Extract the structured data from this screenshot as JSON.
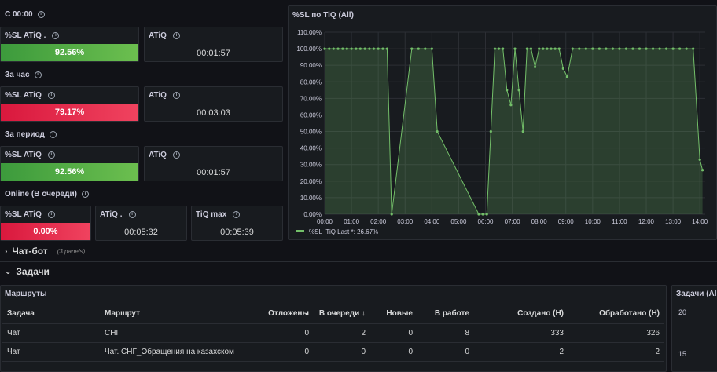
{
  "sections": {
    "since_midnight": "С 00:00",
    "per_hour": "За час",
    "per_period": "За период",
    "online": "Online (В очереди)"
  },
  "stats": {
    "r1_sl": {
      "title": "%SL ATiQ .",
      "value": "92.56%"
    },
    "r1_atiq": {
      "title": "ATiQ",
      "value": "00:01:57"
    },
    "r2_sl": {
      "title": "%SL ATiQ",
      "value": "79.17%"
    },
    "r2_atiq": {
      "title": "ATiQ",
      "value": "00:03:03"
    },
    "r3_sl": {
      "title": "%SL ATiQ",
      "value": "92.56%"
    },
    "r3_atiq": {
      "title": "ATiQ",
      "value": "00:01:57"
    },
    "r4_sl": {
      "title": "%SL ATiQ",
      "value": "0.00%"
    },
    "r4_atiq": {
      "title": "ATiQ .",
      "value": "00:05:32"
    },
    "r4_tiqmax": {
      "title": "TiQ max",
      "value": "00:05:39"
    }
  },
  "colors": {
    "green": "#56a64b",
    "red": "#e02f44",
    "line": "#73bf69"
  },
  "chart_data": {
    "type": "line",
    "title": "%SL по TiQ (All)",
    "series": [
      {
        "name": "%SL_TiQ",
        "points": [
          [
            0.0,
            100
          ],
          [
            0.17,
            100
          ],
          [
            0.33,
            100
          ],
          [
            0.5,
            100
          ],
          [
            0.67,
            100
          ],
          [
            0.83,
            100
          ],
          [
            1.0,
            100
          ],
          [
            1.17,
            100
          ],
          [
            1.33,
            100
          ],
          [
            1.5,
            100
          ],
          [
            1.67,
            100
          ],
          [
            1.83,
            100
          ],
          [
            2.0,
            100
          ],
          [
            2.17,
            100
          ],
          [
            2.33,
            100
          ],
          [
            2.5,
            0
          ],
          [
            3.25,
            100
          ],
          [
            3.5,
            100
          ],
          [
            3.75,
            100
          ],
          [
            4.0,
            100
          ],
          [
            4.2,
            50
          ],
          [
            5.75,
            0
          ],
          [
            5.9,
            0
          ],
          [
            6.05,
            0
          ],
          [
            6.2,
            50
          ],
          [
            6.35,
            100
          ],
          [
            6.5,
            100
          ],
          [
            6.65,
            100
          ],
          [
            6.8,
            75
          ],
          [
            6.95,
            66
          ],
          [
            7.1,
            100
          ],
          [
            7.25,
            75
          ],
          [
            7.4,
            50
          ],
          [
            7.55,
            100
          ],
          [
            7.7,
            100
          ],
          [
            7.85,
            89
          ],
          [
            8.0,
            100
          ],
          [
            8.15,
            100
          ],
          [
            8.3,
            100
          ],
          [
            8.45,
            100
          ],
          [
            8.6,
            100
          ],
          [
            8.75,
            100
          ],
          [
            8.9,
            88
          ],
          [
            9.05,
            83
          ],
          [
            9.25,
            100
          ],
          [
            9.5,
            100
          ],
          [
            9.75,
            100
          ],
          [
            10.0,
            100
          ],
          [
            10.25,
            100
          ],
          [
            10.5,
            100
          ],
          [
            10.75,
            100
          ],
          [
            11.0,
            100
          ],
          [
            11.25,
            100
          ],
          [
            11.5,
            100
          ],
          [
            11.75,
            100
          ],
          [
            12.0,
            100
          ],
          [
            12.25,
            100
          ],
          [
            12.5,
            100
          ],
          [
            12.75,
            100
          ],
          [
            13.0,
            100
          ],
          [
            13.25,
            100
          ],
          [
            13.5,
            100
          ],
          [
            13.75,
            100
          ],
          [
            14.0,
            33
          ],
          [
            14.1,
            26.67
          ]
        ]
      }
    ],
    "x_ticks": [
      "00:00",
      "01:00",
      "02:00",
      "03:00",
      "04:00",
      "05:00",
      "06:00",
      "07:00",
      "08:00",
      "09:00",
      "10:00",
      "11:00",
      "12:00",
      "13:00",
      "14:00"
    ],
    "y_ticks": [
      "0.00%",
      "10.00%",
      "20.00%",
      "30.00%",
      "40.00%",
      "50.00%",
      "60.00%",
      "70.00%",
      "80.00%",
      "90.00%",
      "100.00%",
      "110.00%"
    ],
    "xlim": [
      0,
      14.2
    ],
    "ylim": [
      0,
      110
    ],
    "legend": "%SL_TiQ  Last *: 26.67%"
  },
  "rows": {
    "chatbot": {
      "title": "Чат-бот",
      "note": "(3 panels)"
    },
    "tasks": {
      "title": "Задачи"
    }
  },
  "routes_table": {
    "title": "Маршруты",
    "headers": [
      "Задача",
      "Маршрут",
      "Отложены",
      "В очереди ↓",
      "Новые",
      "В работе",
      "Создано (Н)",
      "Обработано (Н)"
    ],
    "rows": [
      [
        "Чат",
        "СНГ",
        "0",
        "2",
        "0",
        "8",
        "333",
        "326"
      ],
      [
        "Чат",
        "Чат. СНГ_Обращения на казахском",
        "0",
        "0",
        "0",
        "0",
        "2",
        "2"
      ]
    ]
  },
  "side_panel": {
    "title": "Задачи (All",
    "y1": "20",
    "y2": "15"
  }
}
